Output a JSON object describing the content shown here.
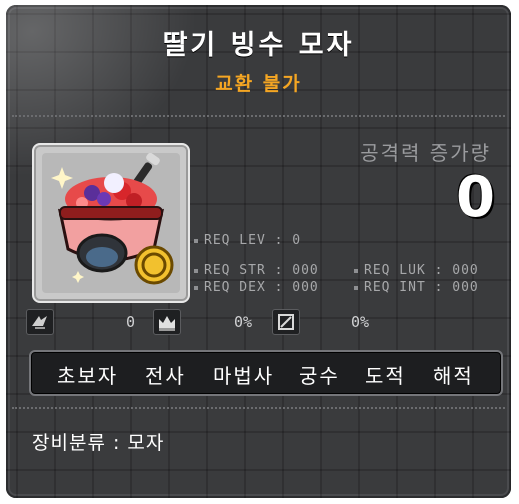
{
  "item": {
    "name": "딸기 빙수 모자",
    "trade_status": "교환 불가",
    "icon": "strawberry-bingsu-hat-icon"
  },
  "attack": {
    "label": "공격력 증가량",
    "value": "0"
  },
  "requirements": {
    "lev": "REQ LEV :  0",
    "str": "REQ STR : 000",
    "dex": "REQ DEX : 000",
    "luk": "REQ LUK : 000",
    "int": "REQ INT : 000"
  },
  "stats": {
    "star_value": "0",
    "upgrade_value": "0%",
    "ignore_value": "0%"
  },
  "jobs": [
    "초보자",
    "전사",
    "마법사",
    "궁수",
    "도적",
    "해적"
  ],
  "category": "장비분류 : 모자",
  "colors": {
    "background": "#3a3b3d",
    "trade_status": "#f5a623",
    "title": "#ffffff"
  }
}
